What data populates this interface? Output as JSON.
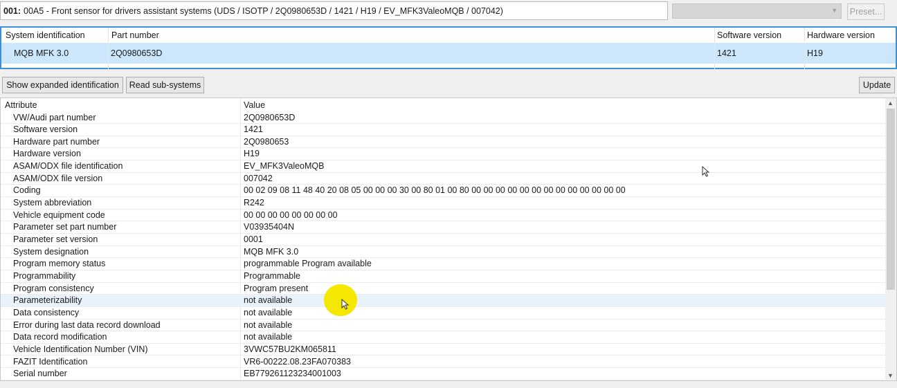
{
  "header": {
    "address": "001:",
    "title": "00A5 - Front sensor for drivers assistant systems  (UDS / ISOTP / 2Q0980653D / 1421 / H19 / EV_MFK3ValeoMQB / 007042)",
    "combo_value": "",
    "preset_label": "Preset..."
  },
  "system_table": {
    "columns": [
      "System identification",
      "Part number",
      "Software version",
      "Hardware version"
    ],
    "row": {
      "system": "MQB MFK 3.0",
      "part": "2Q0980653D",
      "software": "1421",
      "hardware": "H19"
    }
  },
  "toolbar": {
    "expanded_label": "Show expanded identification",
    "subsystems_label": "Read sub-systems",
    "update_label": "Update"
  },
  "attributes": {
    "header_attribute": "Attribute",
    "header_value": "Value",
    "rows": [
      {
        "attr": "VW/Audi part number",
        "value": "2Q0980653D"
      },
      {
        "attr": "Software version",
        "value": "1421"
      },
      {
        "attr": "Hardware part number",
        "value": "2Q0980653"
      },
      {
        "attr": "Hardware version",
        "value": "H19"
      },
      {
        "attr": "ASAM/ODX file identification",
        "value": "EV_MFK3ValeoMQB"
      },
      {
        "attr": "ASAM/ODX file version",
        "value": "007042"
      },
      {
        "attr": "Coding",
        "value": "00 02 09 08 11 48 40 20 08 05 00 00 00 30 00 80 01 00 80 00 00 00 00 00 00 00 00 00 00 00 00 00"
      },
      {
        "attr": "System abbreviation",
        "value": "R242"
      },
      {
        "attr": "Vehicle equipment code",
        "value": "00 00 00 00 00 00 00 00"
      },
      {
        "attr": "Parameter set part number",
        "value": "V03935404N"
      },
      {
        "attr": "Parameter set version",
        "value": "0001"
      },
      {
        "attr": "System designation",
        "value": "MQB MFK 3.0"
      },
      {
        "attr": "Program memory status",
        "value": "programmable Program available"
      },
      {
        "attr": "Programmability",
        "value": "Programmable"
      },
      {
        "attr": "Program consistency",
        "value": "Program present"
      },
      {
        "attr": "Parameterizability",
        "value": "not available"
      },
      {
        "attr": "Data consistency",
        "value": "not available"
      },
      {
        "attr": "Error during last data record download",
        "value": "not available"
      },
      {
        "attr": "Data record modification",
        "value": "not available"
      },
      {
        "attr": "Vehicle Identification Number (VIN)",
        "value": "3VWC57BU2KM065811"
      },
      {
        "attr": "FAZIT Identification",
        "value": "VR6-00222.08.23FA070383"
      },
      {
        "attr": "Serial number",
        "value": "EB779261123234001003"
      }
    ]
  },
  "colors": {
    "selection": "#cce6fb",
    "focus_border": "#3c8fd6",
    "highlight_spot": "#f4e700"
  }
}
